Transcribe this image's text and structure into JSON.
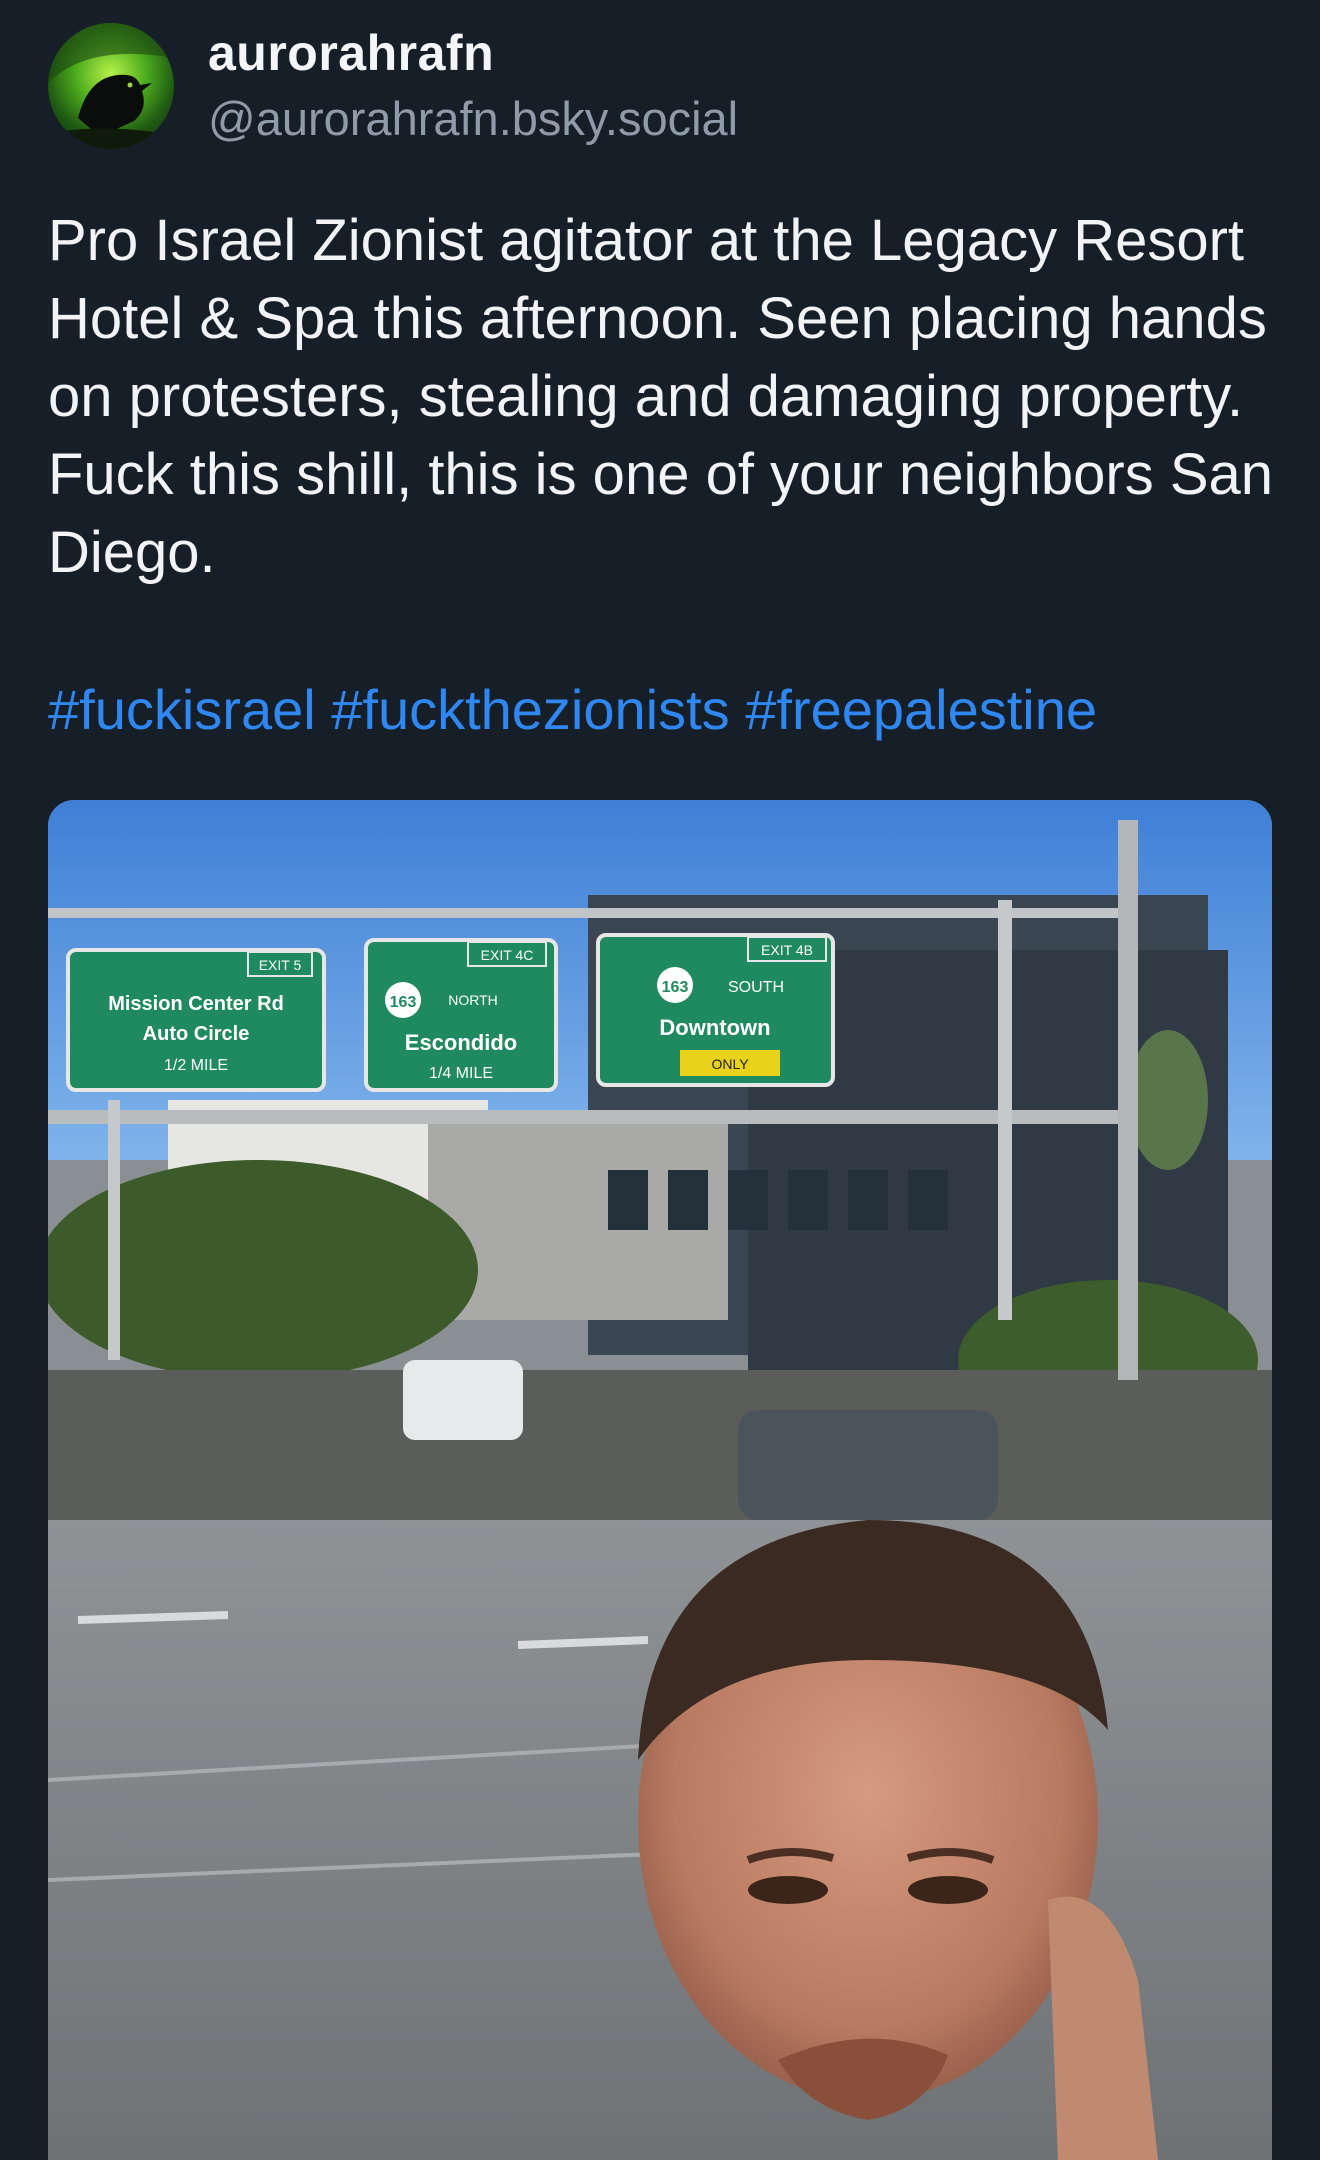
{
  "post": {
    "author": {
      "display_name": "aurorahrafn",
      "handle": "@aurorahrafn.bsky.social",
      "avatar_icon": "raven-aurora-avatar"
    },
    "text": "Pro Israel Zionist agitator at the Legacy Resort Hotel & Spa this afternoon. Seen placing hands on protesters, stealing and damaging property. Fuck this shill, this is one of your neighbors San Diego.",
    "hashtags": [
      "#fuckisrael",
      "#fuckthezionists",
      "#freepalestine"
    ],
    "media": {
      "type": "video-still",
      "signs": {
        "left": {
          "exit": "EXIT 5",
          "line1": "Mission Center Rd",
          "line2": "Auto Circle",
          "line3": "1/2 MILE"
        },
        "middle": {
          "exit": "EXIT 4C",
          "route": "163",
          "direction": "NORTH",
          "line1": "Escondido",
          "line2": "1/4 MILE"
        },
        "right": {
          "exit": "EXIT 4B",
          "route": "163",
          "direction": "SOUTH",
          "line1": "Downtown",
          "line2": "ONLY"
        }
      }
    }
  },
  "colors": {
    "background": "#161e27",
    "link": "#2f87f2",
    "handle": "#8f9ba8",
    "text": "#f1f3f5",
    "sign_green": "#1f8a5f"
  }
}
